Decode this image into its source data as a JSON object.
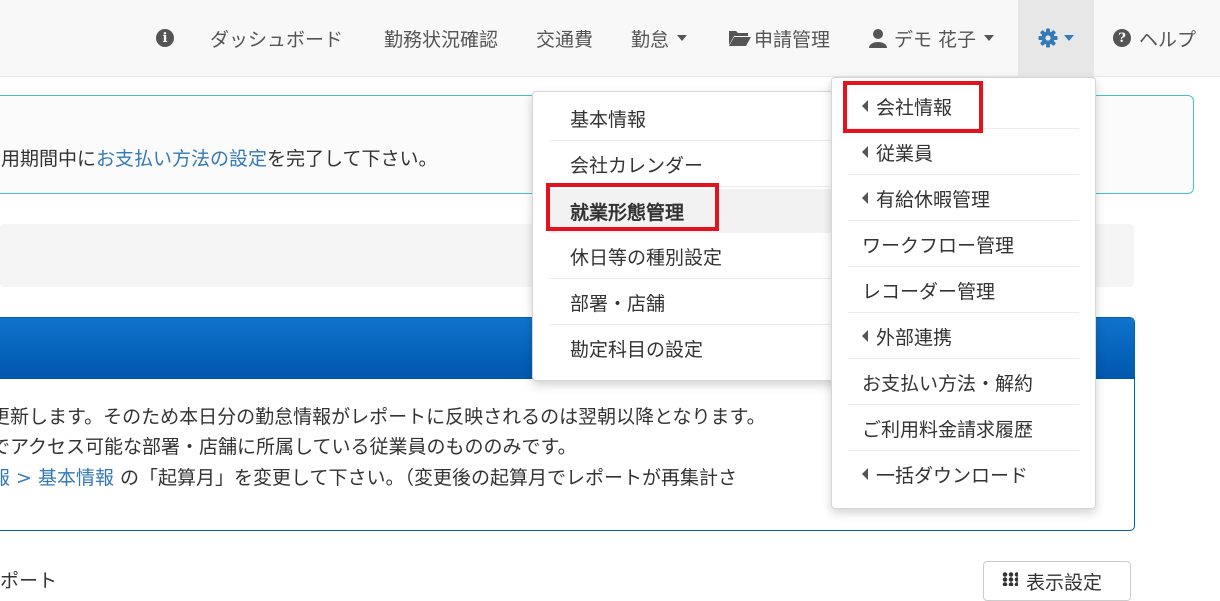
{
  "navbar": {
    "items": [
      {
        "label": "ダッシュボード"
      },
      {
        "label": "勤務状況確認"
      },
      {
        "label": "交通費"
      },
      {
        "label": "勤怠"
      },
      {
        "label": "申請管理"
      },
      {
        "label": "デモ 花子"
      },
      {
        "label": "ヘルプ"
      }
    ],
    "info_icon": "i",
    "help_icon": "?"
  },
  "alert": {
    "text_before": "用期間中に",
    "link": "お支払い方法の設定",
    "text_after": "を完了して下さい。"
  },
  "panel": {
    "line1": "更新します。そのため本日分の勤怠情報がレポートに反映されるのは翌朝以降となります。",
    "line2": "でアクセス可能な部署・店舗に所属している従業員のもののみです。",
    "line3_link1": "報 > 基本情報",
    "line3_rest": " の「起算月」を変更して下さい。（変更後の起算月でレポートが再集計さ"
  },
  "bottom": {
    "title": "ポート",
    "display_button": "表示設定"
  },
  "settings_menu": {
    "items": [
      {
        "label": "会社情報",
        "submenu": true
      },
      {
        "label": "従業員",
        "submenu": true
      },
      {
        "label": "有給休暇管理",
        "submenu": true
      },
      {
        "label": "ワークフロー管理",
        "submenu": false
      },
      {
        "label": "レコーダー管理",
        "submenu": false
      },
      {
        "label": "外部連携",
        "submenu": true
      },
      {
        "label": "お支払い方法・解約",
        "submenu": false
      },
      {
        "label": "ご利用料金請求履歴",
        "submenu": false
      },
      {
        "label": "一括ダウンロード",
        "submenu": true
      }
    ]
  },
  "company_submenu": {
    "items": [
      {
        "label": "基本情報"
      },
      {
        "label": "会社カレンダー"
      },
      {
        "label": "就業形態管理"
      },
      {
        "label": "休日等の種別設定"
      },
      {
        "label": "部署・店舗"
      },
      {
        "label": "勘定科目の設定"
      }
    ]
  },
  "colors": {
    "accent": "#337ab7",
    "highlight": "#e3121e",
    "panel_header": "#0060b6",
    "alert_border": "#41c4c9"
  }
}
